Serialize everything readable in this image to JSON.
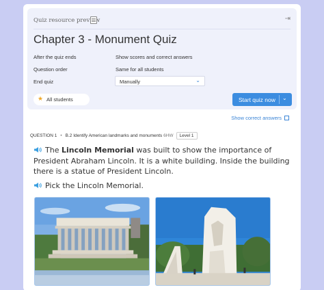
{
  "header": {
    "preview_label": "Quiz resource preview",
    "title": "Chapter 3 - Monument Quiz"
  },
  "settings": [
    {
      "label": "After the quiz ends",
      "value": "Show scores and correct answers"
    },
    {
      "label": "Question order",
      "value": "Same for all students"
    },
    {
      "label": "End quiz",
      "value": "Manually"
    }
  ],
  "audience": {
    "label": "All students"
  },
  "start_button": {
    "label": "Start quiz now"
  },
  "show_answers": {
    "label": "Show correct answers"
  },
  "question": {
    "number": "QUESTION 1",
    "skill": "B.2 Identify American landmarks and monuments",
    "code": "6HW",
    "level": "Level 1",
    "passage_pre": "The ",
    "passage_bold": "Lincoln Memorial",
    "passage_post": " was built to show the importance of President Abraham Lincoln. It is a white building. Inside the building there is a statue of President Lincoln.",
    "prompt": "Pick the Lincoln Memorial."
  },
  "choices": [
    {
      "name": "Lincoln Memorial photo"
    },
    {
      "name": "Martin Luther King Jr. Memorial photo"
    }
  ],
  "colors": {
    "accent": "#3c8de0",
    "background": "#c9cdf3",
    "panel": "#eff1fb"
  }
}
